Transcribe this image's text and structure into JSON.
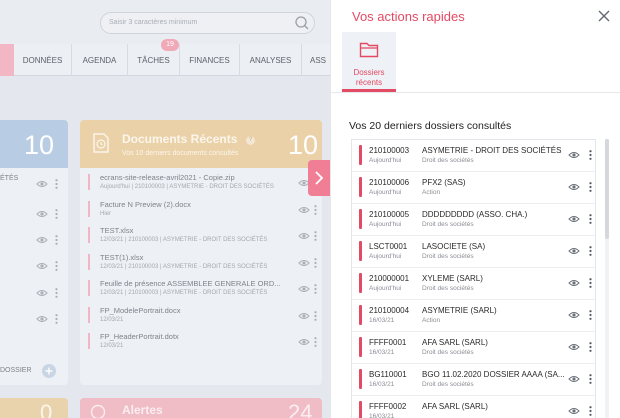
{
  "search": {
    "placeholder": "Saisir 3 caractères minimum"
  },
  "nav": {
    "tabs": [
      "DONNÉES",
      "AGENDA",
      "TÂCHES",
      "FINANCES",
      "ANALYSES",
      "ASS"
    ],
    "tasks_badge": "19"
  },
  "left_card": {
    "count": "10",
    "row_label": "ÉTÉS",
    "footer_label": "DOSSIER"
  },
  "docs_card": {
    "title": "Documents Récents",
    "subtitle": "Vos 10 derniers documents consultés",
    "count": "10",
    "help": "?",
    "items": [
      {
        "name": "ecrans-site-release-avril2021 - Copie.zip",
        "meta": "Aujourd'hui | 210100003 | ASYMETRIE - DROIT DES SOCIÉTÉS"
      },
      {
        "name": "Facture N Preview (2).docx",
        "meta": "Hier"
      },
      {
        "name": "TEST.xlsx",
        "meta": "12/03/21 | 210100003 | ASYMETRIE - DROIT DES SOCIÉTÉS"
      },
      {
        "name": "TEST(1).xlsx",
        "meta": "12/03/21 | 210100003 | ASYMETRIE - DROIT DES SOCIÉTÉS"
      },
      {
        "name": "Feuille de présence ASSEMBLEE GENERALE ORD...",
        "meta": "12/03/21 | 210100003 | ASYMETRIE - DROIT DES SOCIÉTÉS"
      },
      {
        "name": "FP_ModelePortrait.docx",
        "meta": "12/03/21"
      },
      {
        "name": "FP_HeaderPortrait.dotx",
        "meta": "12/03/21"
      }
    ]
  },
  "bottom": {
    "alerts_label": "Alertes",
    "left_num": "0",
    "right_num": "24"
  },
  "panel": {
    "title": "Vos actions rapides",
    "tab_label_line1": "Dossiers",
    "tab_label_line2": "récents",
    "heading": "Vos 20 derniers dossiers consultés",
    "rows": [
      {
        "code": "210100003",
        "date": "Aujourd'hui",
        "name": "ASYMETRIE - DROIT DES SOCIÉTÉS",
        "type": "Droit des sociétés"
      },
      {
        "code": "210100006",
        "date": "Aujourd'hui",
        "name": "PFX2 (SAS)",
        "type": "Action"
      },
      {
        "code": "210100005",
        "date": "Aujourd'hui",
        "name": "DDDDDDDDD (ASSO. CHA.)",
        "type": "Droit des sociétés"
      },
      {
        "code": "LSCT0001",
        "date": "Aujourd'hui",
        "name": "LASOCIETE (SA)",
        "type": "Droit des sociétés"
      },
      {
        "code": "210000001",
        "date": "Aujourd'hui",
        "name": "XYLEME (SARL)",
        "type": "Droit des sociétés"
      },
      {
        "code": "210100004",
        "date": "16/03/21",
        "name": "ASYMETRIE (SARL)",
        "type": "Action"
      },
      {
        "code": "FFFF0001",
        "date": "16/03/21",
        "name": "AFA SARL (SARL)",
        "type": "Droit des sociétés"
      },
      {
        "code": "BG110001",
        "date": "16/03/21",
        "name": "BGO 11.02.2020 DOSSIER AAAA (SA...",
        "type": "Droit des sociétés"
      },
      {
        "code": "FFFF0002",
        "date": "16/03/21",
        "name": "AFA SARL (SARL)",
        "type": ""
      }
    ]
  },
  "colors": {
    "accent": "#e34a64",
    "docs_header": "#ead1a8",
    "left_header": "#b8cde3"
  }
}
